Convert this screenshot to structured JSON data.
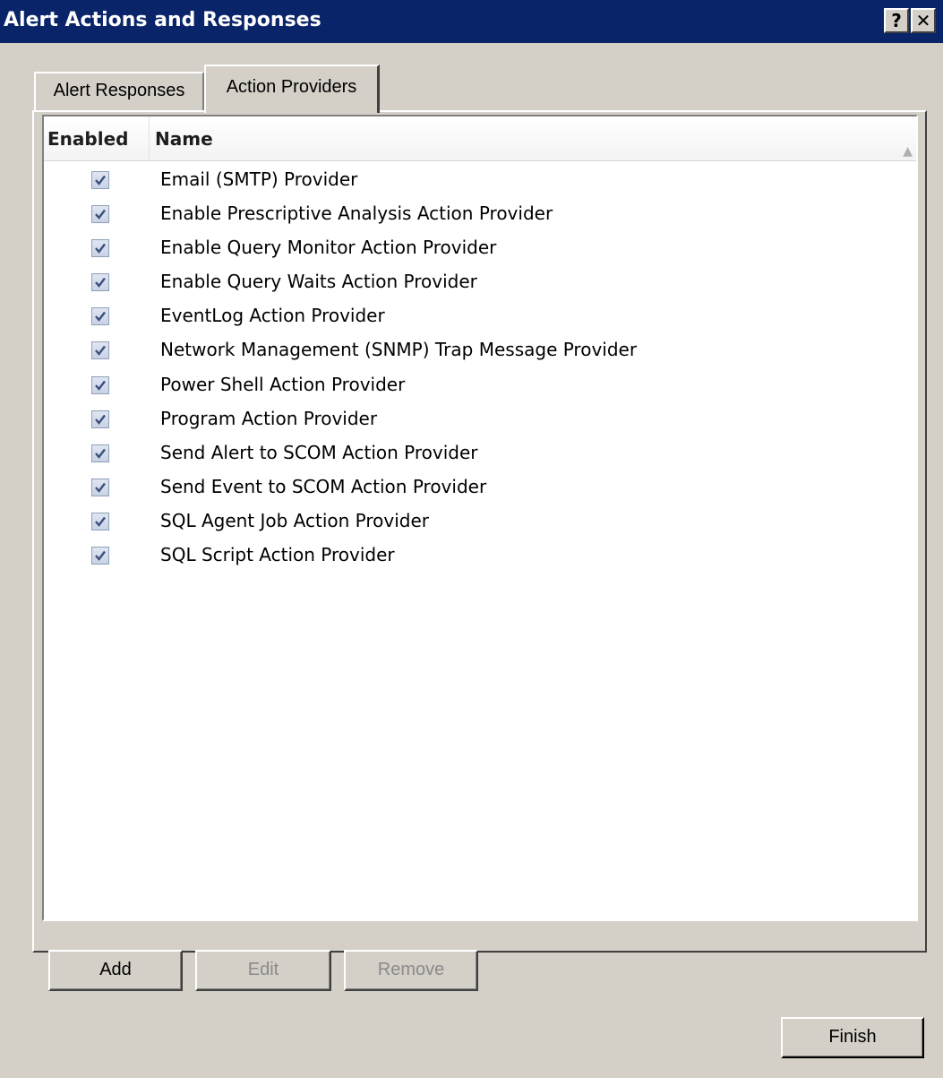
{
  "window": {
    "title": "Alert Actions and Responses",
    "help_glyph": "?",
    "close_glyph": "✕"
  },
  "tabs": [
    {
      "label": "Alert Responses",
      "active": false
    },
    {
      "label": "Action Providers",
      "active": true
    }
  ],
  "list": {
    "columns": {
      "enabled": "Enabled",
      "name": "Name"
    },
    "sort_glyph": "▲",
    "rows": [
      {
        "enabled": true,
        "name": "Email (SMTP) Provider"
      },
      {
        "enabled": true,
        "name": "Enable Prescriptive Analysis Action Provider"
      },
      {
        "enabled": true,
        "name": "Enable Query Monitor Action Provider"
      },
      {
        "enabled": true,
        "name": "Enable Query Waits Action Provider"
      },
      {
        "enabled": true,
        "name": "EventLog Action Provider"
      },
      {
        "enabled": true,
        "name": "Network Management (SNMP) Trap Message Provider"
      },
      {
        "enabled": true,
        "name": "Power Shell Action Provider"
      },
      {
        "enabled": true,
        "name": "Program Action Provider"
      },
      {
        "enabled": true,
        "name": "Send Alert to SCOM Action Provider"
      },
      {
        "enabled": true,
        "name": "Send Event to SCOM Action Provider"
      },
      {
        "enabled": true,
        "name": "SQL Agent Job Action Provider"
      },
      {
        "enabled": true,
        "name": "SQL Script Action Provider"
      }
    ]
  },
  "buttons": {
    "add": {
      "label": "Add",
      "enabled": true
    },
    "edit": {
      "label": "Edit",
      "enabled": false
    },
    "remove": {
      "label": "Remove",
      "enabled": false
    },
    "finish": {
      "label": "Finish",
      "enabled": true
    }
  },
  "colors": {
    "titlebar": "#0a246a",
    "dialog_face": "#d4d0c8",
    "checkbox_check": "#3c4f7a"
  }
}
